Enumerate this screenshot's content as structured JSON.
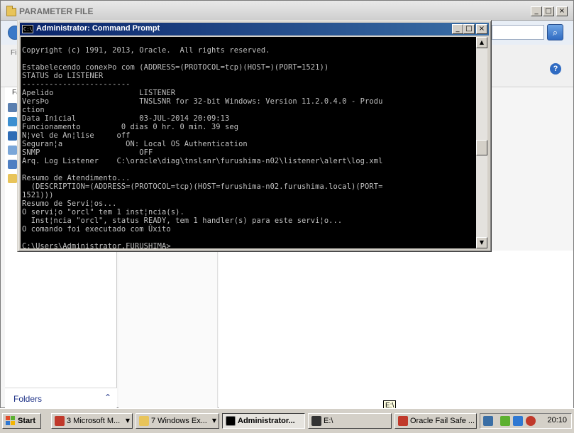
{
  "explorer": {
    "title": "PARAMETER FILE",
    "menu_stub": "Fil",
    "nav_stub": "Fa",
    "folders_label": "Folders",
    "folders_chevron": "^"
  },
  "cmd": {
    "title": "Administrator: Command Prompt",
    "sys_icon": "C:\\",
    "lines": [
      "",
      "Copyright (c) 1991, 2013, Oracle.  All rights reserved.",
      "",
      "Estabelecendo conexÞo com (ADDRESS=(PROTOCOL=tcp)(HOST=)(PORT=1521))",
      "STATUS do LISTENER",
      "------------------------",
      "Apelido                   LISTENER",
      "VersÞo                    TNSLSNR for 32-bit Windows: Version 11.2.0.4.0 - Produ",
      "ction",
      "Data Inicial              03-JUL-2014 20:09:13",
      "Funcionamento         0 dias 0 hr. 0 min. 39 seg",
      "N¦vel de An¦lise     off",
      "Seguran¦a              ON: Local OS Authentication",
      "SNMP                      OFF",
      "Arq. Log Listener    C:\\oracle\\diag\\tnslsnr\\furushima-n02\\listener\\alert\\log.xml",
      "",
      "Resumo de Atendimento...",
      "  (DESCRIPTION=(ADDRESS=(PROTOCOL=tcp)(HOST=furushima-n02.furushima.local)(PORT=",
      "1521)))",
      "Resumo de Servi¦os...",
      "O servi¦o \"orcl\" tem 1 inst¦ncia(s).",
      "  Inst¦ncia \"orcl\", status READY, tem 1 handler(s) para este servi¦o...",
      "O comando foi executado com Ûxito",
      "",
      "C:\\Users\\Administrator.FURUSHIMA>"
    ]
  },
  "taskbar": {
    "start": "Start",
    "items": [
      {
        "label": "3 Microsoft M...",
        "color": "#c0392b"
      },
      {
        "label": "7 Windows Ex...",
        "color": "#e8c45a"
      },
      {
        "label": "Administrator...",
        "color": "#000000"
      },
      {
        "label": "E:\\",
        "color": "#333333"
      },
      {
        "label": "Oracle Fail Safe ...",
        "color": "#c0392b"
      }
    ],
    "clock": "20:10"
  },
  "tooltip": "E:\\",
  "colors": {
    "cmd_title_start": "#0a246a",
    "cmd_title_end": "#3a6ea5",
    "console_bg": "#000000",
    "console_text": "#c0c0c0"
  }
}
